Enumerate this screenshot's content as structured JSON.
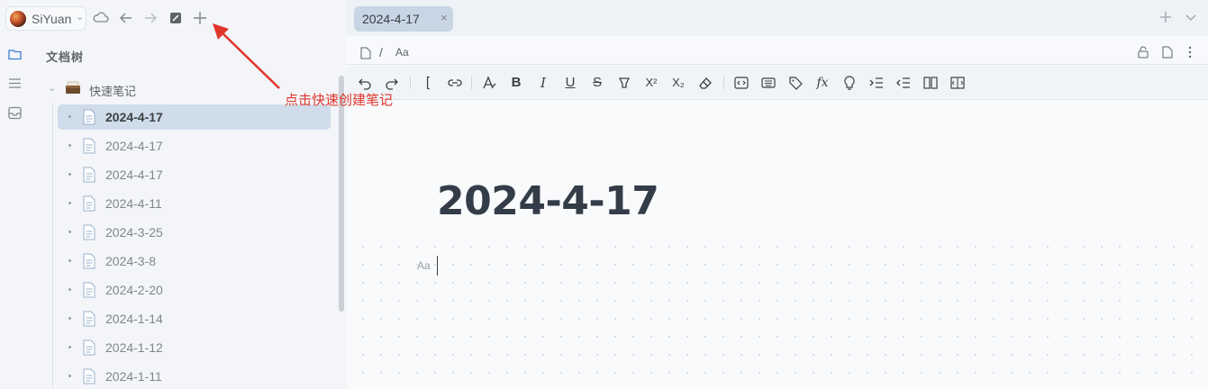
{
  "topbar": {
    "user_name": "SiYuan",
    "icons": [
      "cloud-sync-icon",
      "back-icon",
      "forward-icon",
      "quick-note-icon",
      "new-note-icon"
    ]
  },
  "sidebar": {
    "rail_icons": [
      "file-tree-icon",
      "outline-icon",
      "inbox-icon"
    ],
    "tree_title": "文档树",
    "notebook": {
      "label": "快速笔记",
      "icon": "card-box-emoji"
    },
    "documents": [
      {
        "label": "2024-4-17",
        "active": true
      },
      {
        "label": "2024-4-17",
        "active": false
      },
      {
        "label": "2024-4-17",
        "active": false
      },
      {
        "label": "2024-4-11",
        "active": false
      },
      {
        "label": "2024-3-25",
        "active": false
      },
      {
        "label": "2024-3-8",
        "active": false
      },
      {
        "label": "2024-2-20",
        "active": false
      },
      {
        "label": "2024-1-14",
        "active": false
      },
      {
        "label": "2024-1-12",
        "active": false
      },
      {
        "label": "2024-1-11",
        "active": false
      }
    ]
  },
  "annotation": {
    "text": "点击快速创建笔记",
    "color": "#e0362c"
  },
  "tabs": [
    {
      "label": "2024-4-17",
      "close": "×"
    }
  ],
  "breadcrumb": {
    "separator": "/",
    "block_type": "Aa"
  },
  "toolbar": {
    "tools": [
      "undo",
      "redo",
      "[",
      "link",
      "font-style",
      "B",
      "I",
      "U",
      "S",
      "mark",
      "X²",
      "X₂",
      "clear",
      "code",
      "kbd",
      "tag",
      "fx",
      "memo",
      "indent",
      "outdent",
      "split-view",
      "fullscreen"
    ]
  },
  "editor": {
    "title": "2024-4-17",
    "block_type": "Aa"
  },
  "colors": {
    "accent_tab": "#c7d5e4",
    "active_item": "#cfdcea",
    "title_text": "#343c48"
  }
}
